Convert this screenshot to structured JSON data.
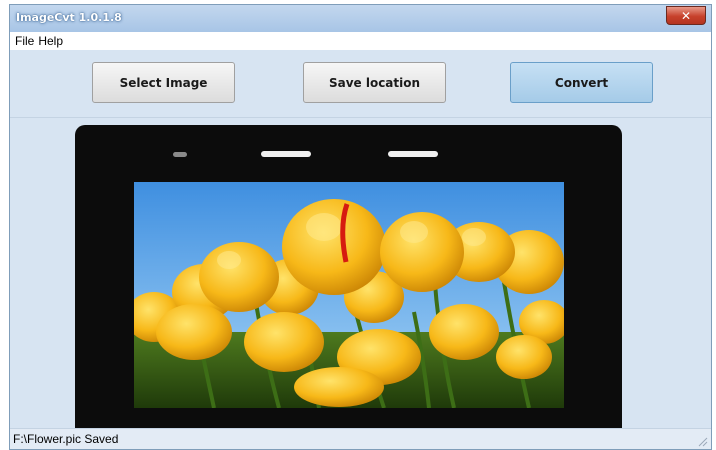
{
  "window": {
    "title": "ImageCvt 1.0.1.8",
    "close_glyph": "✕"
  },
  "menu": {
    "items": [
      "File",
      "Help"
    ]
  },
  "toolbar": {
    "select_label": "Select Image",
    "save_label": "Save location",
    "convert_label": "Convert"
  },
  "preview": {
    "image_icon": "tulips-photo",
    "device_icon": "phone-frame"
  },
  "status": {
    "text": "F:\\Flower.pic Saved"
  },
  "colors": {
    "accent": "#a5cbe8",
    "window_bg": "#d7e4f2",
    "close_red": "#c7412b"
  }
}
